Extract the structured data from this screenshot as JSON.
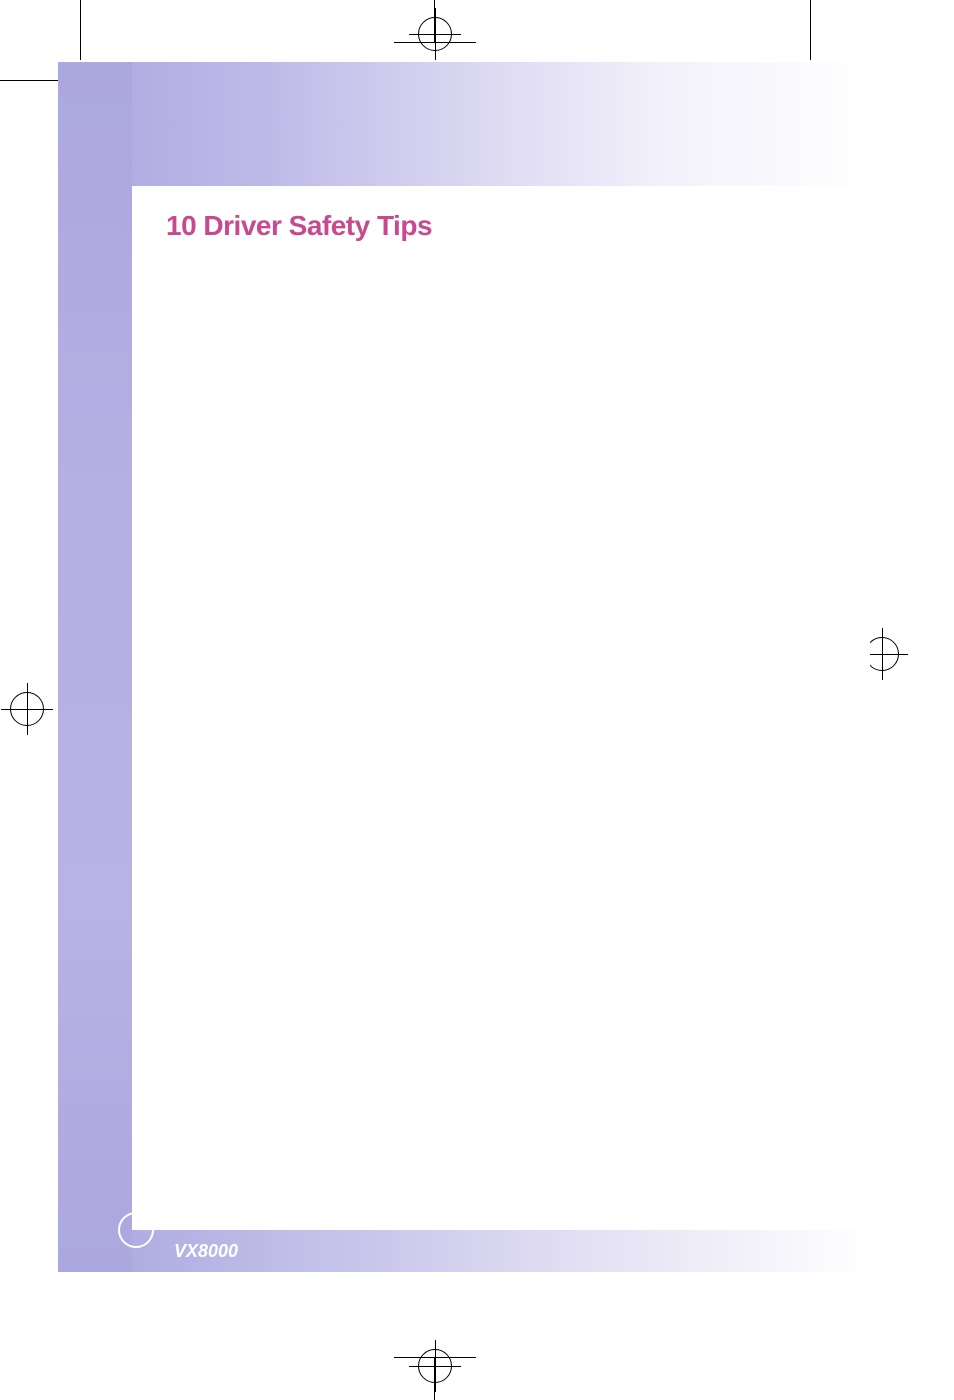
{
  "heading": "10 Driver Safety Tips",
  "footer_model": "VX8000"
}
